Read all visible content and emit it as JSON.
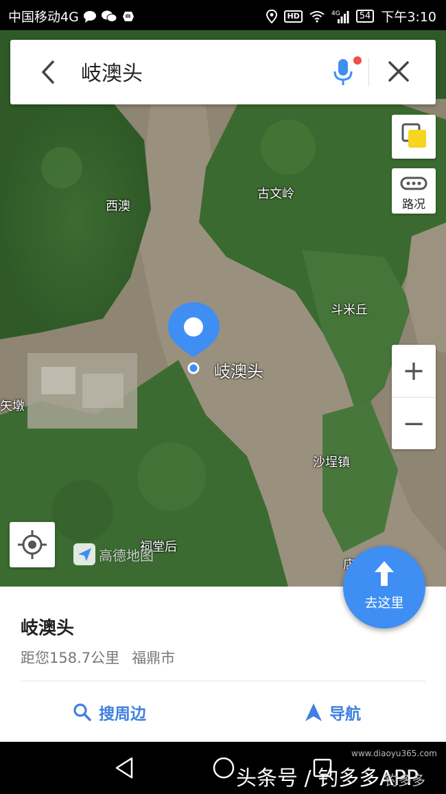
{
  "status_bar": {
    "carrier": "中国移动4G",
    "network_label": "4G",
    "hd_label": "HD",
    "battery": "54",
    "time": "下午3:10"
  },
  "search": {
    "query": "岐澳头"
  },
  "map": {
    "traffic_label": "路况",
    "zoom_in": "+",
    "zoom_out": "−",
    "pin_label": "岐澳头",
    "labels": [
      "古文岭",
      "西澳",
      "斗米丘",
      "矢墩",
      "沙埕镇",
      "祠堂后",
      "店"
    ],
    "logo_text": "高德地图"
  },
  "goto": {
    "label": "去这里"
  },
  "panel": {
    "place_name": "岐澳头",
    "distance": "距您158.7公里",
    "city": "福鼎市",
    "search_nearby": "搜周边",
    "navigate": "导航"
  },
  "watermark": {
    "text": "头条号 / 钓多多APP",
    "url": "www.diaoyu365.com",
    "corner": "钓多多"
  },
  "colors": {
    "accent": "#3f8ef4",
    "action_text": "#3f7fe0"
  }
}
